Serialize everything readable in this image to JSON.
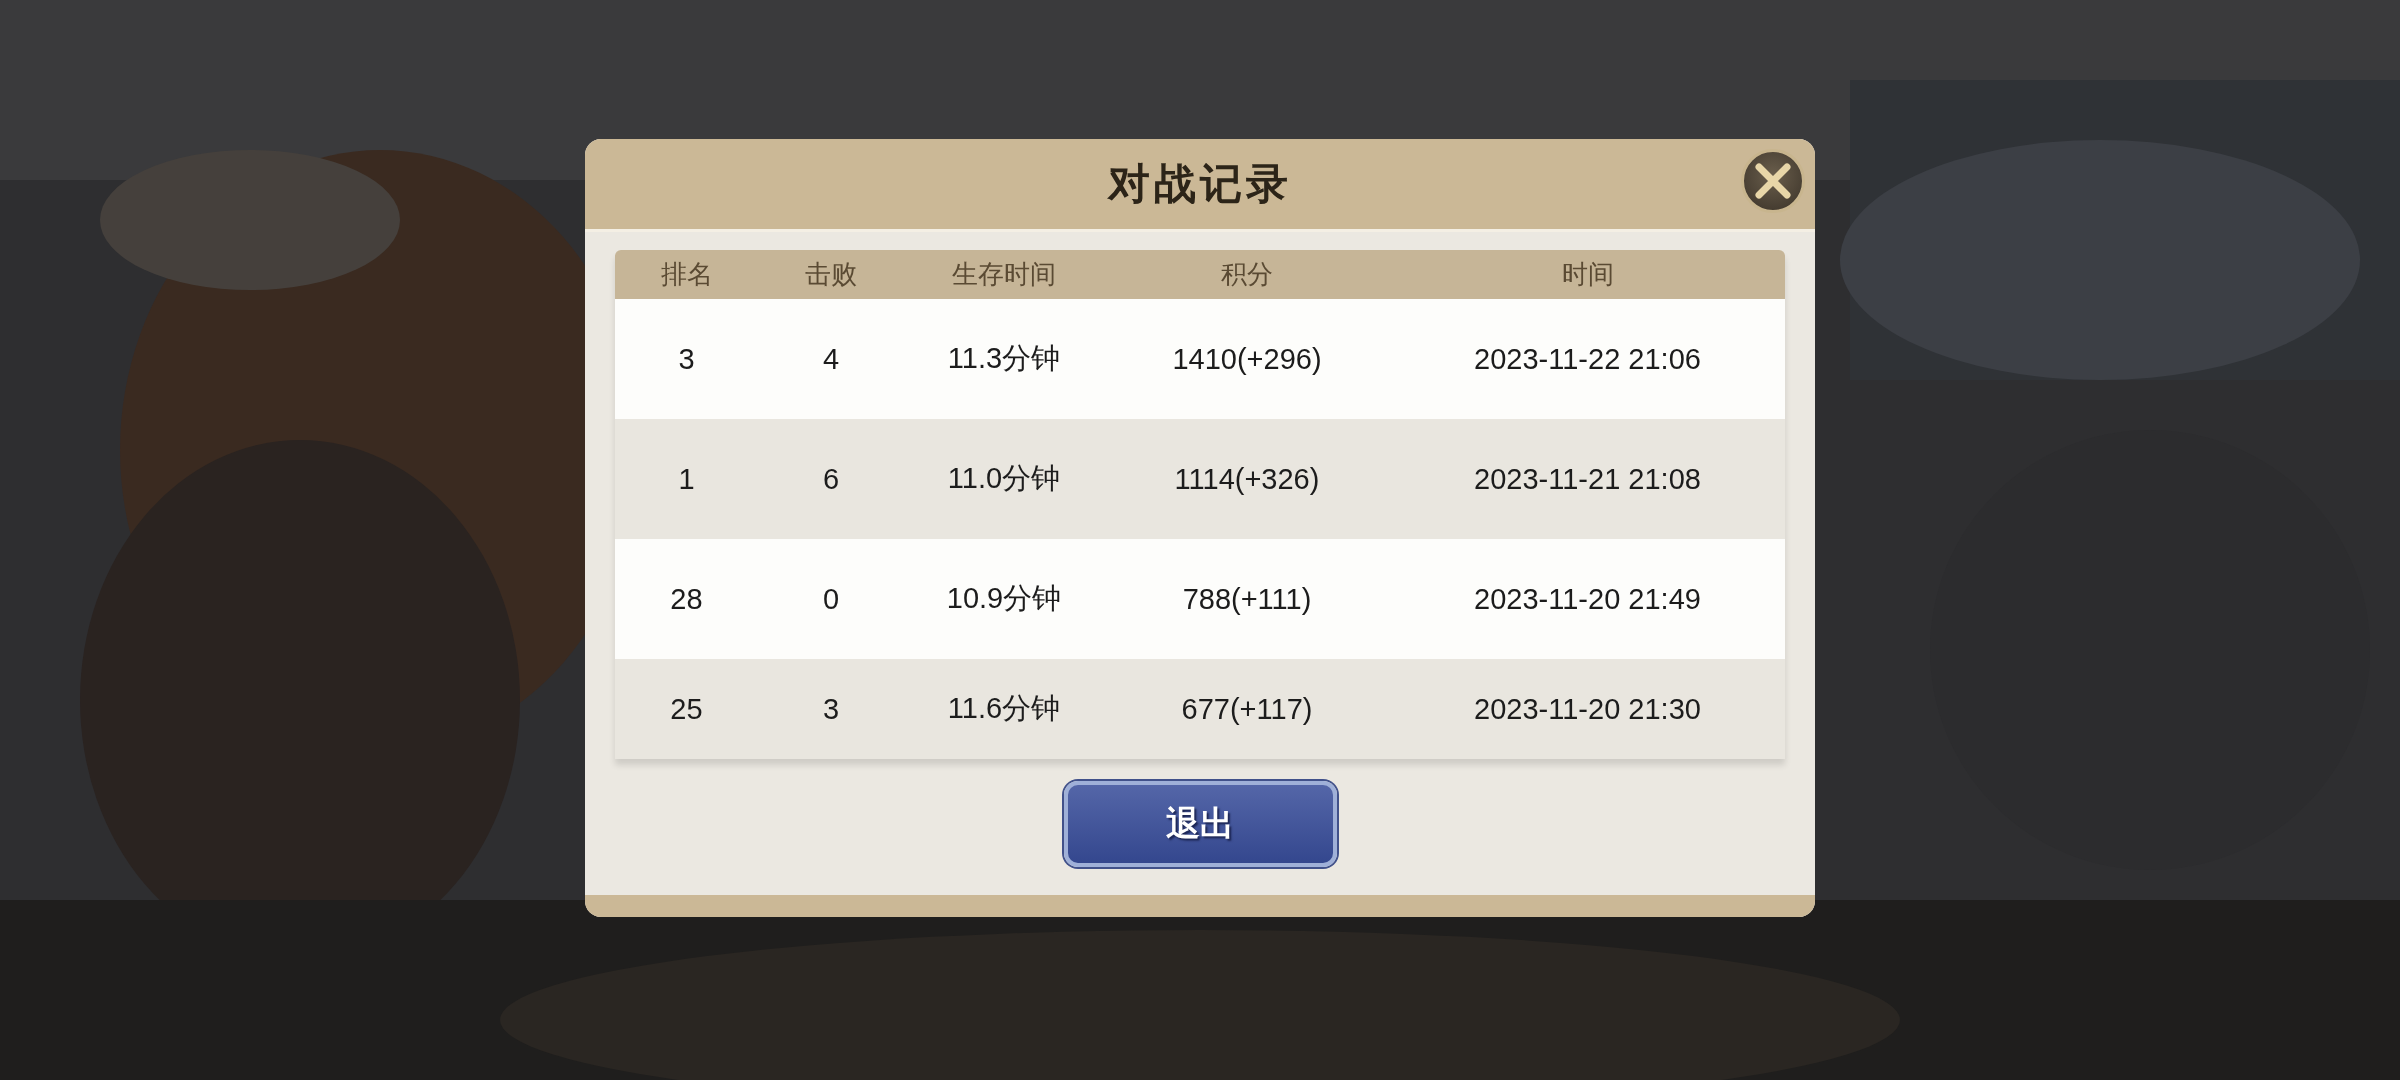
{
  "dialog": {
    "title": "对战记录",
    "table": {
      "columns": [
        "排名",
        "击败",
        "生存时间",
        "积分",
        "时间"
      ],
      "rows": [
        [
          "3",
          "4",
          "11.3分钟",
          "1410(+296)",
          "2023-11-22 21:06"
        ],
        [
          "1",
          "6",
          "11.0分钟",
          "1114(+326)",
          "2023-11-21 21:08"
        ],
        [
          "28",
          "0",
          "10.9分钟",
          "788(+111)",
          "2023-11-20 21:49"
        ],
        [
          "25",
          "3",
          "11.6分钟",
          "677(+117)",
          "2023-11-20 21:30"
        ]
      ]
    },
    "exit_button": "退出"
  }
}
